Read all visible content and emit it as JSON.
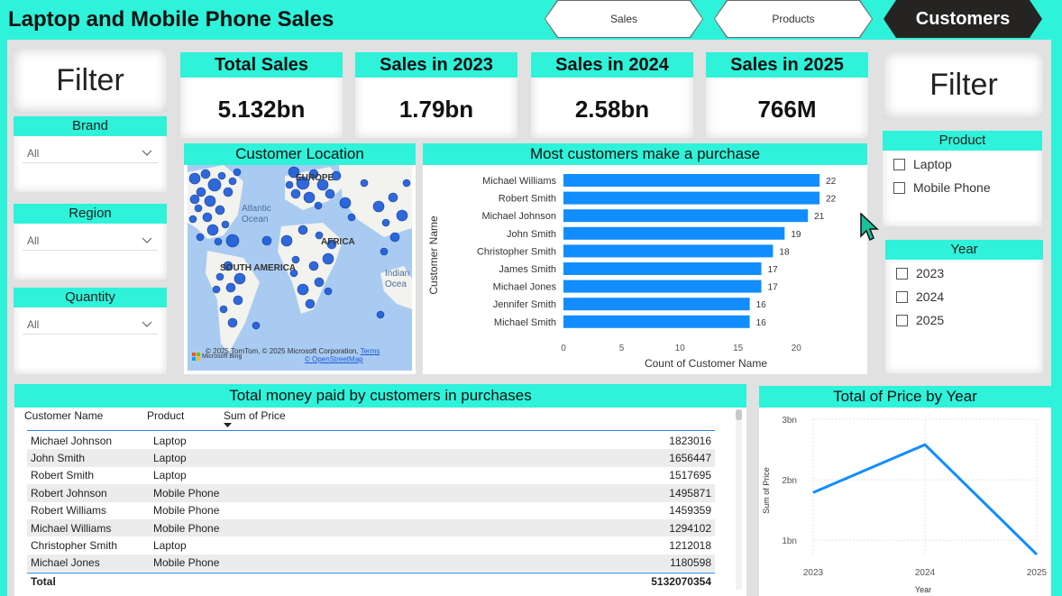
{
  "header": {
    "title": "Laptop and Mobile Phone Sales"
  },
  "nav_tabs": [
    {
      "label": "Sales"
    },
    {
      "label": "Products"
    },
    {
      "label": "Customers"
    }
  ],
  "left_filter": {
    "title": "Filter",
    "slicers": [
      {
        "label": "Brand",
        "value": "All"
      },
      {
        "label": "Region",
        "value": "All"
      },
      {
        "label": "Quantity",
        "value": "All"
      }
    ]
  },
  "kpis": [
    {
      "label": "Total Sales",
      "value": "5.132bn"
    },
    {
      "label": "Sales in 2023",
      "value": "1.79bn"
    },
    {
      "label": "Sales in 2024",
      "value": "2.58bn"
    },
    {
      "label": "Sales in 2025",
      "value": "766M"
    }
  ],
  "map": {
    "title": "Customer Location",
    "labels": {
      "europe": "EUROPE",
      "africa": "AFRICA",
      "south_america": "SOUTH AMERICA",
      "atlantic": "Atlantic Ocean",
      "indian": "Indian Ocea"
    },
    "attribution": "© 2025 TomTom, © 2025 Microsoft Corporation,",
    "terms": "Terms",
    "osm": "© OpenStreetMap",
    "bing": "Microsoft Bing"
  },
  "bar_chart": {
    "title": "Most customers make a purchase",
    "chart_data": {
      "type": "bar",
      "orientation": "horizontal",
      "categories": [
        "Michael Williams",
        "Robert Smith",
        "Michael Johnson",
        "John Smith",
        "Christopher Smith",
        "James Smith",
        "Michael Jones",
        "Jennifer Smith",
        "Michael Smith"
      ],
      "values": [
        22,
        22,
        21,
        19,
        18,
        17,
        17,
        16,
        16
      ],
      "xlabel": "Count of Customer Name",
      "ylabel": "Customer Name",
      "xticks": [
        "0",
        "5",
        "10",
        "15",
        "20"
      ],
      "xlim": [
        0,
        23
      ],
      "color": "#118dff",
      "data_labels": true
    }
  },
  "right_filter": {
    "title": "Filter",
    "product": {
      "label": "Product",
      "options": [
        "Laptop",
        "Mobile Phone"
      ]
    },
    "year": {
      "label": "Year",
      "options": [
        "2023",
        "2024",
        "2025"
      ]
    }
  },
  "table": {
    "title": "Total money paid by customers in purchases",
    "columns": [
      "Customer Name",
      "Product",
      "Sum of Price"
    ],
    "rows": [
      [
        "Michael Johnson",
        "Laptop",
        "1823016"
      ],
      [
        "John Smith",
        "Laptop",
        "1656447"
      ],
      [
        "Robert Smith",
        "Laptop",
        "1517695"
      ],
      [
        "Robert Johnson",
        "Mobile Phone",
        "1495871"
      ],
      [
        "Robert Williams",
        "Mobile Phone",
        "1459359"
      ],
      [
        "Michael Williams",
        "Mobile Phone",
        "1294102"
      ],
      [
        "Christopher Smith",
        "Laptop",
        "1212018"
      ],
      [
        "Michael Jones",
        "Mobile Phone",
        "1180598"
      ]
    ],
    "total_label": "Total",
    "total_value": "5132070354"
  },
  "line_chart": {
    "title": "Total of Price by Year",
    "chart_data": {
      "type": "line",
      "x": [
        "2023",
        "2024",
        "2025"
      ],
      "values": [
        1.79,
        2.58,
        0.766
      ],
      "ylabel": "Sum of Price",
      "xlabel": "Year",
      "yticks": [
        "1bn",
        "2bn",
        "3bn"
      ],
      "ytick_values": [
        1,
        2,
        3
      ],
      "ylim": [
        0.75,
        3.0
      ],
      "color": "#118dff",
      "grid": true
    }
  }
}
